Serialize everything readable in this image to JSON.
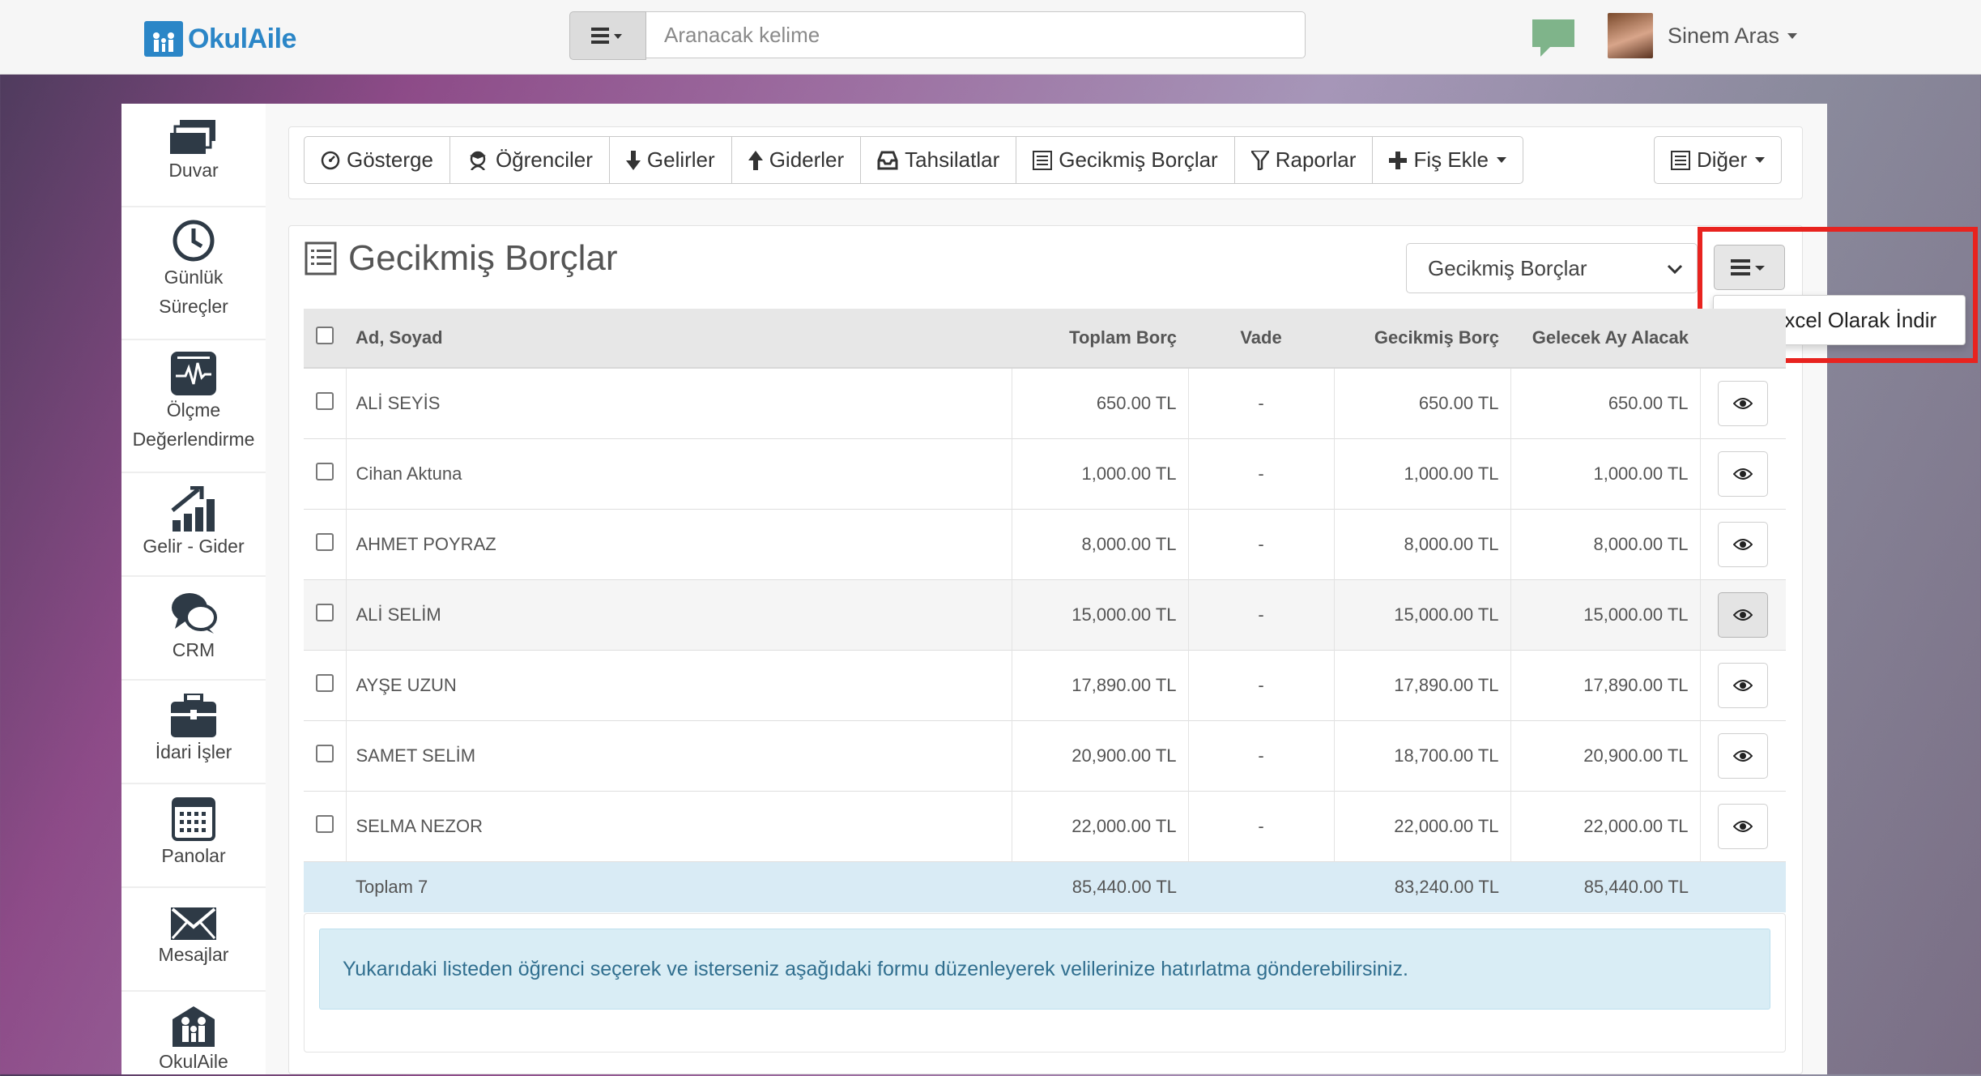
{
  "brand": {
    "name": "OkulAile",
    "color": "#2b86c7"
  },
  "search": {
    "placeholder": "Aranacak kelime"
  },
  "user": {
    "name": "Sinem Aras"
  },
  "sidebar": {
    "items": [
      {
        "label": "Duvar",
        "icon": "wall-icon"
      },
      {
        "label": "Günlük",
        "label2": "Süreçler",
        "icon": "clock-icon"
      },
      {
        "label": "Ölçme",
        "label2": "Değerlendirme",
        "icon": "monitor-pulse-icon"
      },
      {
        "label": "Gelir - Gider",
        "icon": "growth-chart-icon"
      },
      {
        "label": "CRM",
        "icon": "chat-bubbles-icon"
      },
      {
        "label": "İdari İşler",
        "icon": "briefcase-icon"
      },
      {
        "label": "Panolar",
        "icon": "calendar-board-icon"
      },
      {
        "label": "Mesajlar",
        "icon": "envelope-icon"
      },
      {
        "label": "OkulAile",
        "icon": "family-icon"
      }
    ]
  },
  "toolbar": {
    "buttons": [
      {
        "label": "Gösterge",
        "icon": "dashboard-icon"
      },
      {
        "label": "Öğrenciler",
        "icon": "students-icon"
      },
      {
        "label": "Gelirler",
        "icon": "arrow-down-icon"
      },
      {
        "label": "Giderler",
        "icon": "arrow-up-icon"
      },
      {
        "label": "Tahsilatlar",
        "icon": "inbox-icon"
      },
      {
        "label": "Gecikmiş Borçlar",
        "icon": "list-alt-icon"
      },
      {
        "label": "Raporlar",
        "icon": "filter-icon"
      },
      {
        "label": "Fiş Ekle",
        "icon": "plus-icon"
      }
    ],
    "other": "Diğer"
  },
  "panel": {
    "title": "Gecikmiş Borçlar",
    "select_value": "Gecikmiş Borçlar",
    "dropdown_item": "Excel Olarak İndir"
  },
  "table": {
    "headers": {
      "name": "Ad, Soyad",
      "total": "Toplam Borç",
      "due": "Vade",
      "overdue": "Gecikmiş Borç",
      "next": "Gelecek Ay Alacak"
    },
    "rows": [
      {
        "name": "ALİ SEYİS",
        "total": "650.00 TL",
        "due": "-",
        "overdue": "650.00 TL",
        "next": "650.00 TL"
      },
      {
        "name": "Cihan Aktuna",
        "total": "1,000.00 TL",
        "due": "-",
        "overdue": "1,000.00 TL",
        "next": "1,000.00 TL"
      },
      {
        "name": "AHMET POYRAZ",
        "total": "8,000.00 TL",
        "due": "-",
        "overdue": "8,000.00 TL",
        "next": "8,000.00 TL"
      },
      {
        "name": "ALİ SELİM",
        "total": "15,000.00 TL",
        "due": "-",
        "overdue": "15,000.00 TL",
        "next": "15,000.00 TL"
      },
      {
        "name": "AYŞE UZUN",
        "total": "17,890.00 TL",
        "due": "-",
        "overdue": "17,890.00 TL",
        "next": "17,890.00 TL"
      },
      {
        "name": "SAMET SELİM",
        "total": "20,900.00 TL",
        "due": "-",
        "overdue": "18,700.00 TL",
        "next": "20,900.00 TL"
      },
      {
        "name": "SELMA NEZOR",
        "total": "22,000.00 TL",
        "due": "-",
        "overdue": "22,000.00 TL",
        "next": "22,000.00 TL"
      }
    ],
    "totals": {
      "label": "Toplam 7",
      "total": "85,440.00 TL",
      "overdue": "83,240.00 TL",
      "next": "85,440.00 TL"
    }
  },
  "info": {
    "text": "Yukarıdaki listeden öğrenci seçerek ve isterseniz aşağıdaki formu düzenleyerek velilerinize hatırlatma gönderebilirsiniz."
  },
  "colors": {
    "highlight": "#e8231f",
    "info_bg": "#d9edf5",
    "total_row_bg": "#d9ebf5"
  }
}
